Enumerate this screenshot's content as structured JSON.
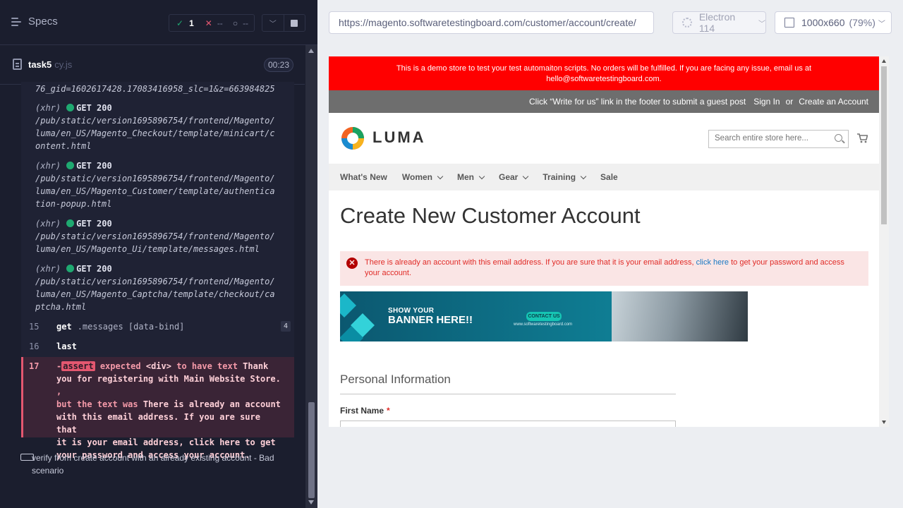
{
  "reporter": {
    "specs_label": "Specs",
    "stats": {
      "passed": "1",
      "failed": "--",
      "pending": "--"
    },
    "spec_file": {
      "name": "task5",
      "ext": "cy.js",
      "duration": "00:23"
    },
    "log_lines": [
      {
        "text": "76_gid=1602617428.17083416958_slc=1&z=663984825"
      }
    ],
    "xhr": [
      {
        "tag": "(xhr)",
        "method": "GET",
        "status": "200",
        "url1": "/pub/static/version1695896754/frontend/Magento/",
        "url2": "luma/en_US/Magento_Checkout/template/minicart/c",
        "url3": "ontent.html"
      },
      {
        "tag": "(xhr)",
        "method": "GET",
        "status": "200",
        "url1": "/pub/static/version1695896754/frontend/Magento/",
        "url2": "luma/en_US/Magento_Customer/template/authentica",
        "url3": "tion-popup.html"
      },
      {
        "tag": "(xhr)",
        "method": "GET",
        "status": "200",
        "url1": "/pub/static/version1695896754/frontend/Magento/",
        "url2": "luma/en_US/Magento_Ui/template/messages.html",
        "url3": ""
      },
      {
        "tag": "(xhr)",
        "method": "GET",
        "status": "200",
        "url1": "/pub/static/version1695896754/frontend/Magento/",
        "url2": "luma/en_US/Magento_Captcha/template/checkout/ca",
        "url3": "ptcha.html"
      }
    ],
    "commands": [
      {
        "num": "15",
        "name": "get",
        "selector": ".messages [data-bind]",
        "badge": "4"
      },
      {
        "num": "16",
        "name": "last",
        "selector": "",
        "badge": ""
      }
    ],
    "error": {
      "num": "17",
      "prefix": "-",
      "tag": "assert",
      "l1a": "expected",
      "l1b": "<div>",
      "l1c": "to have text",
      "l1d": "Thank",
      "l2": "you for registering with Main Website Store.",
      "l2b": ",",
      "l3a": "but the text was",
      "l3b": "There is already an account",
      "l4": "with this email address. If you are sure that",
      "l5": "it is your email address, click here to get",
      "l6": "your password and access your account."
    },
    "test_title_1": "verify from create account with an already existing account - Bad",
    "test_title_2": "scenario"
  },
  "aut": {
    "url": "https://magento.softwaretestingboard.com/customer/account/create/",
    "browser": "Electron 114",
    "viewport": "1000x660",
    "zoom": "(79%)"
  },
  "site": {
    "demo_line1": "This is a demo store to test your test automaiton scripts. No orders will be fulfilled. If you are facing any issue, email us at",
    "demo_line2": "hello@softwaretestingboard.com.",
    "guest_post": "Click “Write for us” link in the footer to submit a guest post",
    "sign_in": "Sign In",
    "or": "or",
    "create_account": "Create an Account",
    "logo": "LUMA",
    "search_placeholder": "Search entire store here...",
    "nav": [
      "What's New",
      "Women",
      "Men",
      "Gear",
      "Training",
      "Sale"
    ],
    "page_title": "Create New Customer Account",
    "error_msg_a": "There is already an account with this email address. If you are sure that it is your email address,",
    "error_msg_link": "click here",
    "error_msg_b": "to get your password and access your account.",
    "banner_t1": "SHOW YOUR",
    "banner_t2": "BANNER HERE!!",
    "banner_btn": "CONTACT US",
    "banner_site": "www.softwaretestingboard.com",
    "section_title": "Personal Information",
    "first_name_label": "First Name",
    "required_mark": "*"
  }
}
